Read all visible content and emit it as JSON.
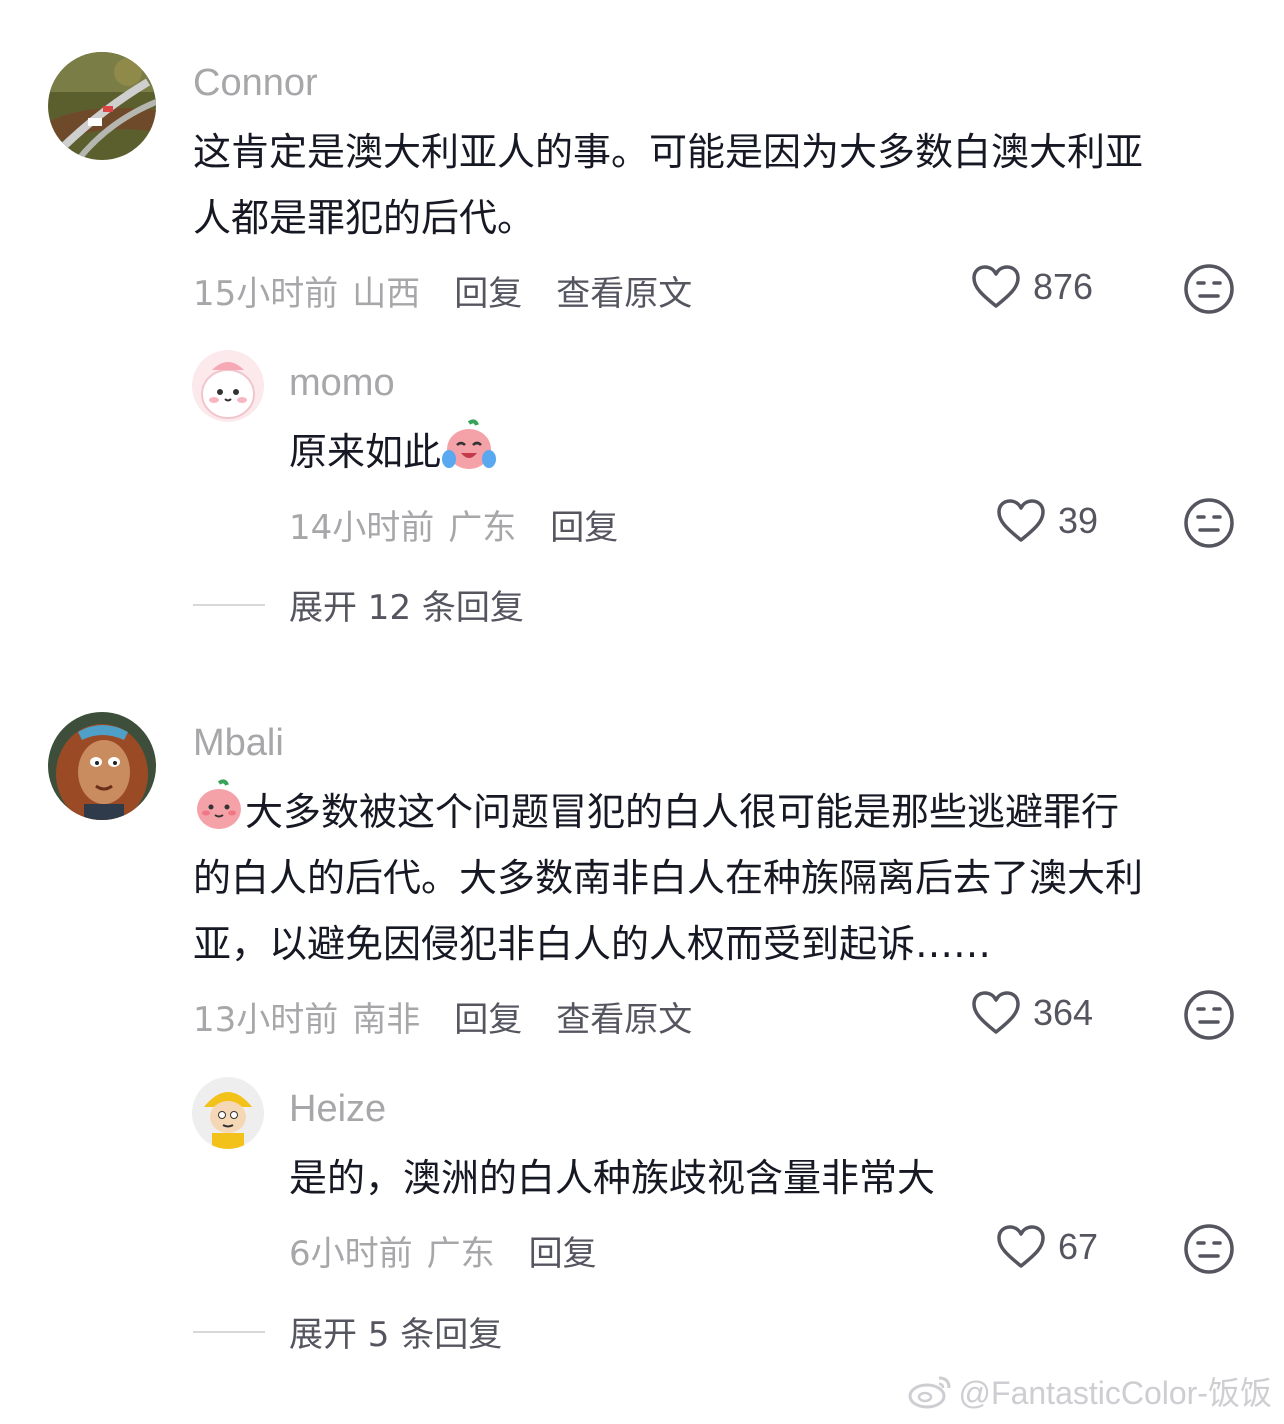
{
  "comments": [
    {
      "author": "Connor",
      "lines": [
        "这肯定是澳大利亚人的事。可能是因为大多数白澳大利亚",
        "人都是罪犯的后代。"
      ],
      "time": "15小时前",
      "region": "山西",
      "reply_label": "回复",
      "view_original_label": "查看原文",
      "likes": "876",
      "reply": {
        "author": "momo",
        "text": "原来如此",
        "emoji": "crying-laughing-peach-emoji",
        "time": "14小时前",
        "region": "广东",
        "reply_label": "回复",
        "likes": "39"
      },
      "expand_label": "展开 12 条回复"
    },
    {
      "author": "Mbali",
      "emoji": "peach-emoji",
      "lines": [
        "大多数被这个问题冒犯的白人很可能是那些逃避罪行",
        "的白人的后代。大多数南非白人在种族隔离后去了澳大利",
        "亚，以避免因侵犯非白人的人权而受到起诉……"
      ],
      "time": "13小时前",
      "region": "南非",
      "reply_label": "回复",
      "view_original_label": "查看原文",
      "likes": "364",
      "reply": {
        "author": "Heize",
        "text": "是的，澳洲的白人种族歧视含量非常大",
        "time": "6小时前",
        "region": "广东",
        "reply_label": "回复",
        "likes": "67"
      },
      "expand_label": "展开 5 条回复"
    }
  ],
  "icons": {
    "like": "heart-outline-icon",
    "dislike": "meh-face-icon",
    "watermark": "weibo-icon"
  },
  "watermark": "@FantasticColor-饭饭"
}
